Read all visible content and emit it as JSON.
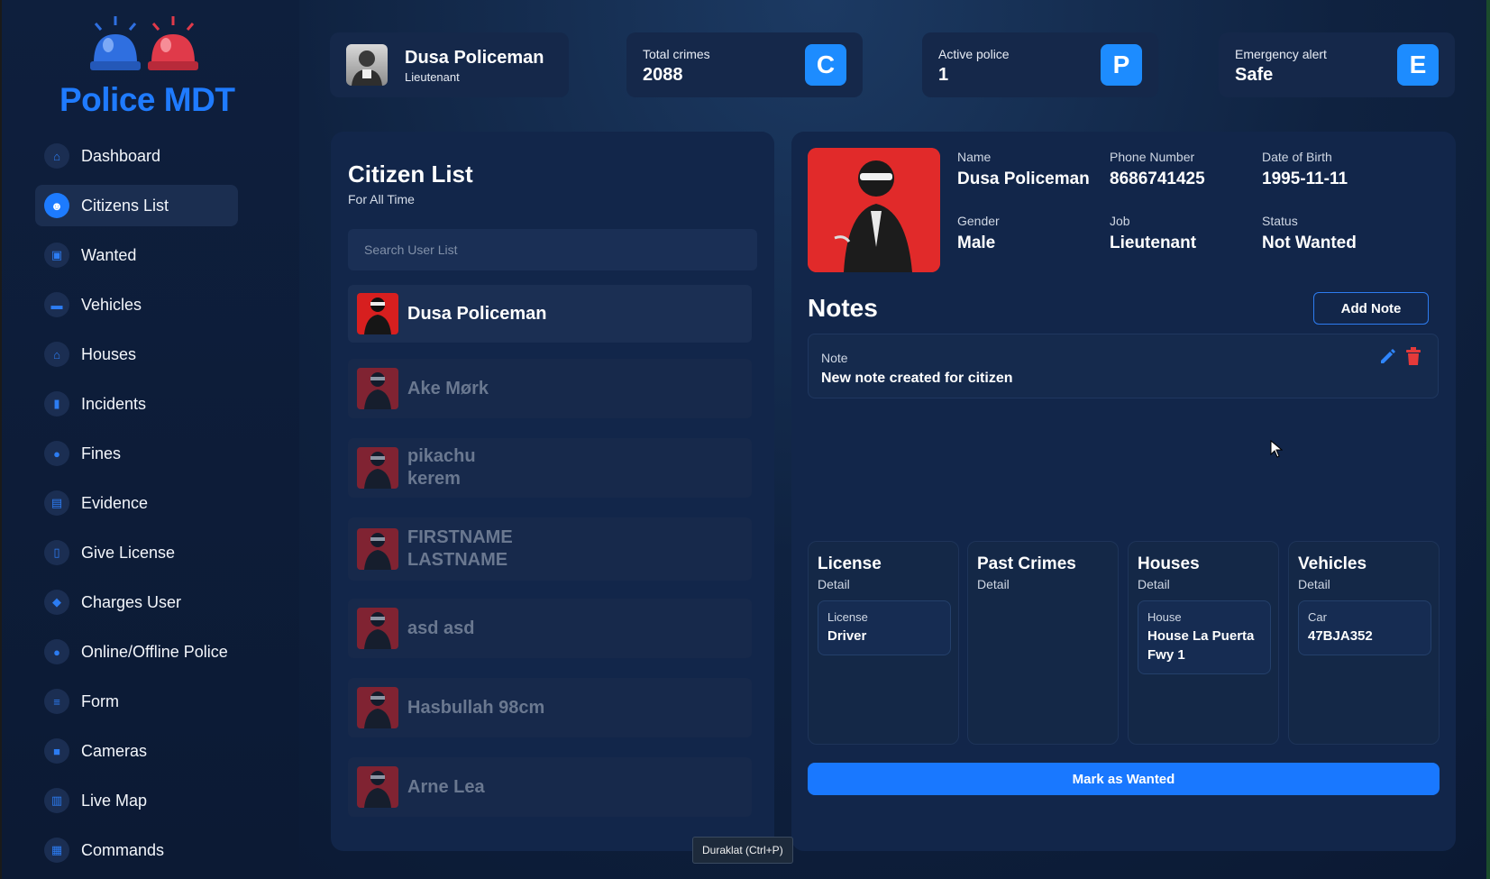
{
  "brand": {
    "title": "Police MDT"
  },
  "sidebar": {
    "items": [
      {
        "label": "Dashboard",
        "icon": "home-icon",
        "glyph": "⌂"
      },
      {
        "label": "Citizens List",
        "icon": "users-icon",
        "glyph": "☻"
      },
      {
        "label": "Wanted",
        "icon": "wanted-icon",
        "glyph": "▣"
      },
      {
        "label": "Vehicles",
        "icon": "car-icon",
        "glyph": "▬"
      },
      {
        "label": "Houses",
        "icon": "house-icon",
        "glyph": "⌂"
      },
      {
        "label": "Incidents",
        "icon": "incident-icon",
        "glyph": "▮"
      },
      {
        "label": "Fines",
        "icon": "info-icon",
        "glyph": "●"
      },
      {
        "label": "Evidence",
        "icon": "evidence-icon",
        "glyph": "▤"
      },
      {
        "label": "Give License",
        "icon": "license-icon",
        "glyph": "▯"
      },
      {
        "label": "Charges User",
        "icon": "charges-icon",
        "glyph": "◆"
      },
      {
        "label": "Online/Offline Police",
        "icon": "police-status-icon",
        "glyph": "●"
      },
      {
        "label": "Form",
        "icon": "form-icon",
        "glyph": "≡"
      },
      {
        "label": "Cameras",
        "icon": "camera-icon",
        "glyph": "■"
      },
      {
        "label": "Live Map",
        "icon": "map-icon",
        "glyph": "▥"
      },
      {
        "label": "Commands",
        "icon": "commands-icon",
        "glyph": "▦"
      }
    ],
    "active_index": 1
  },
  "header": {
    "user": {
      "name": "Dusa Policeman",
      "rank": "Lieutenant"
    },
    "stats": [
      {
        "label": "Total crimes",
        "value": "2088",
        "badge": "C"
      },
      {
        "label": "Active police",
        "value": "1",
        "badge": "P"
      },
      {
        "label": "Emergency alert",
        "value": "Safe",
        "badge": "E"
      }
    ]
  },
  "citizen_list": {
    "title": "Citizen List",
    "subtitle": "For All Time",
    "search_placeholder": "Search User List",
    "items": [
      "Dusa Policeman",
      "Ake Mørk",
      "pikachu kerem",
      "FIRSTNAME LASTNAME",
      "asd asd",
      "Hasbullah 98cm",
      "Arne Lea"
    ],
    "selected_index": 0
  },
  "profile": {
    "fields": [
      {
        "label": "Name",
        "value": "Dusa Policeman"
      },
      {
        "label": "Phone Number",
        "value": "8686741425"
      },
      {
        "label": "Date of Birth",
        "value": "1995-11-11"
      },
      {
        "label": "Gender",
        "value": "Male"
      },
      {
        "label": "Job",
        "value": "Lieutenant"
      },
      {
        "label": "Status",
        "value": "Not Wanted"
      }
    ]
  },
  "notes": {
    "title": "Notes",
    "add_label": "Add Note",
    "items": [
      {
        "label": "Note",
        "text": "New note created for citizen"
      }
    ]
  },
  "details": [
    {
      "title": "License",
      "sub": "Detail",
      "item_label": "License",
      "item_value": "Driver"
    },
    {
      "title": "Past Crimes",
      "sub": "Detail"
    },
    {
      "title": "Houses",
      "sub": "Detail",
      "item_label": "House",
      "item_value": "House La Puerta Fwy 1"
    },
    {
      "title": "Vehicles",
      "sub": "Detail",
      "item_label": "Car",
      "item_value": "47BJA352"
    }
  ],
  "actions": {
    "mark_wanted": "Mark as Wanted"
  },
  "tooltip": {
    "text": "Duraklat (Ctrl+P)"
  },
  "colors": {
    "accent": "#1d7bff",
    "danger": "#e02a2a",
    "panel": "#12264a"
  }
}
